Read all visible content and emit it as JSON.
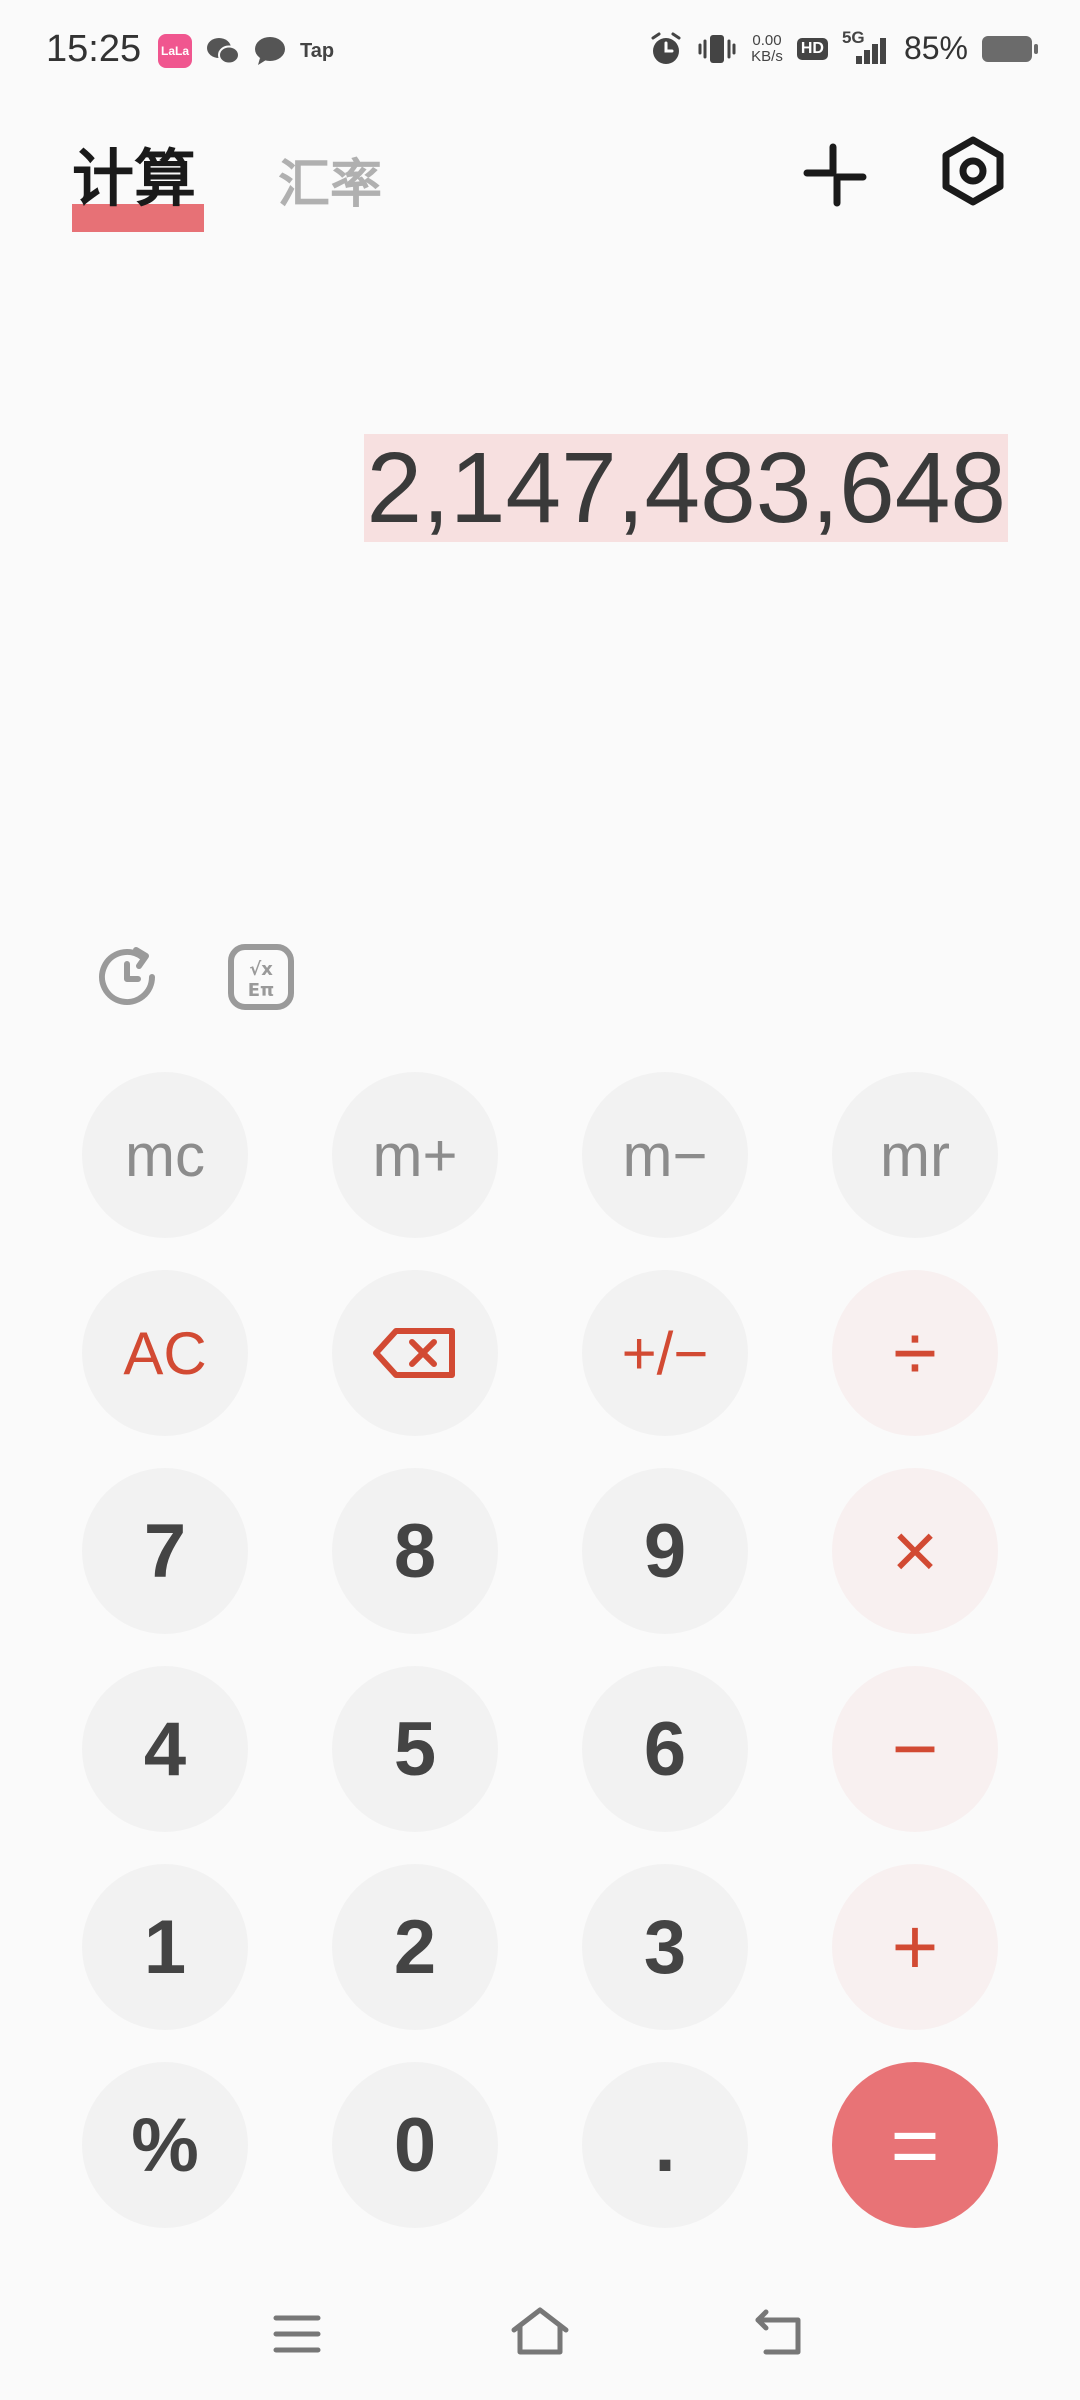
{
  "status_bar": {
    "time": "15:25",
    "app_badge": "LaLa",
    "tap_label": "Tap",
    "net_speed_value": "0.00",
    "net_speed_unit": "KB/s",
    "hd_label": "HD",
    "network_label": "5G",
    "battery_percent": "85%"
  },
  "tabs": {
    "calculate": "计算",
    "exchange_rate": "汇率"
  },
  "display": {
    "value": "2,147,483,648"
  },
  "keys": {
    "mc": "mc",
    "m_plus": "m+",
    "m_minus": "m−",
    "mr": "mr",
    "ac": "AC",
    "sign": "+/−",
    "divide": "÷",
    "seven": "7",
    "eight": "8",
    "nine": "9",
    "multiply": "×",
    "four": "4",
    "five": "5",
    "six": "6",
    "minus": "−",
    "one": "1",
    "two": "2",
    "three": "3",
    "plus": "+",
    "percent": "%",
    "zero": "0",
    "decimal": ".",
    "equals": "="
  },
  "colors": {
    "accent": "#e87376",
    "operator_text": "#d24a33",
    "key_background": "#f2f2f2",
    "operator_background": "#f8f0f0",
    "display_highlight": "#f7e0e0"
  }
}
